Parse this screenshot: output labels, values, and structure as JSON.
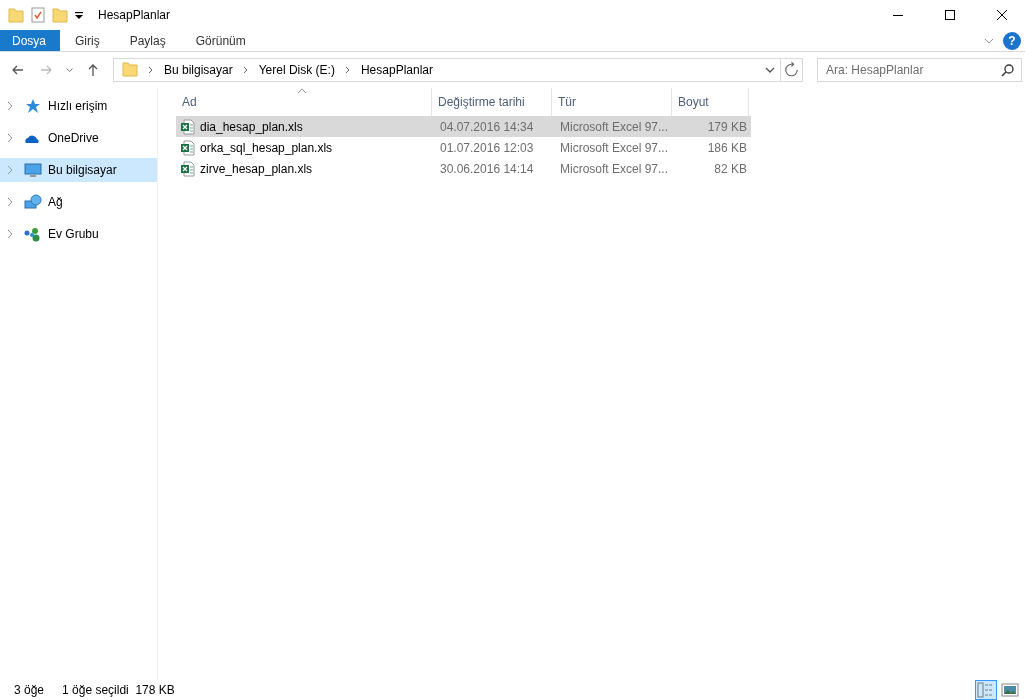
{
  "window": {
    "title": "HesapPlanlar"
  },
  "ribbon_tabs": [
    {
      "label": "Dosya",
      "selected": true
    },
    {
      "label": "Giriş",
      "selected": false
    },
    {
      "label": "Paylaş",
      "selected": false
    },
    {
      "label": "Görünüm",
      "selected": false
    }
  ],
  "address": {
    "crumbs": [
      "Bu bilgisayar",
      "Yerel Disk (E:)",
      "HesapPlanlar"
    ]
  },
  "help_button": "?",
  "search": {
    "placeholder": "Ara: HesapPlanlar"
  },
  "sidebar": {
    "items": [
      {
        "label": "Hızlı erişim",
        "kind": "star",
        "selected": false
      },
      {
        "label": "OneDrive",
        "kind": "cloud",
        "selected": false
      },
      {
        "label": "Bu bilgisayar",
        "kind": "computer",
        "selected": true
      },
      {
        "label": "Ağ",
        "kind": "network",
        "selected": false
      },
      {
        "label": "Ev Grubu",
        "kind": "group",
        "selected": false
      }
    ]
  },
  "table": {
    "columns": [
      "Ad",
      "Değiştirme tarihi",
      "Tür",
      "Boyut"
    ],
    "rows": [
      {
        "name": "dia_hesap_plan.xls",
        "date": "04.07.2016 14:34",
        "type": "Microsoft Excel 97...",
        "size": "179 KB",
        "selected": true
      },
      {
        "name": "orka_sql_hesap_plan.xls",
        "date": "01.07.2016 12:03",
        "type": "Microsoft Excel 97...",
        "size": "186 KB",
        "selected": false
      },
      {
        "name": "zirve_hesap_plan.xls",
        "date": "30.06.2016 14:14",
        "type": "Microsoft Excel 97...",
        "size": "82 KB",
        "selected": false
      }
    ]
  },
  "status_bar": {
    "count": "3 öğe",
    "selection": "1 öğe seçildi  178 KB"
  },
  "view_buttons": [
    {
      "kind": "details",
      "selected": true
    },
    {
      "kind": "thumbnails",
      "selected": false
    }
  ]
}
